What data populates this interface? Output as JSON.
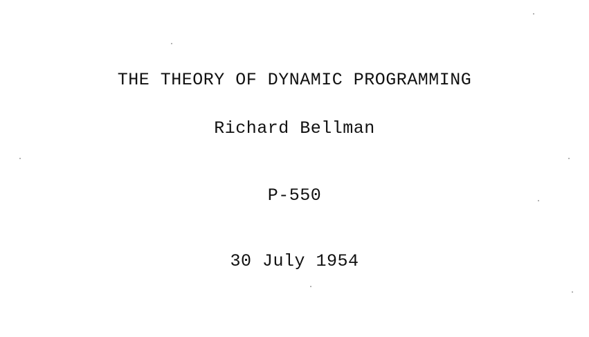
{
  "document": {
    "title": "THE THEORY OF DYNAMIC PROGRAMMING",
    "author": "Richard Bellman",
    "report_number": "P-550",
    "date": "30 July 1954"
  }
}
